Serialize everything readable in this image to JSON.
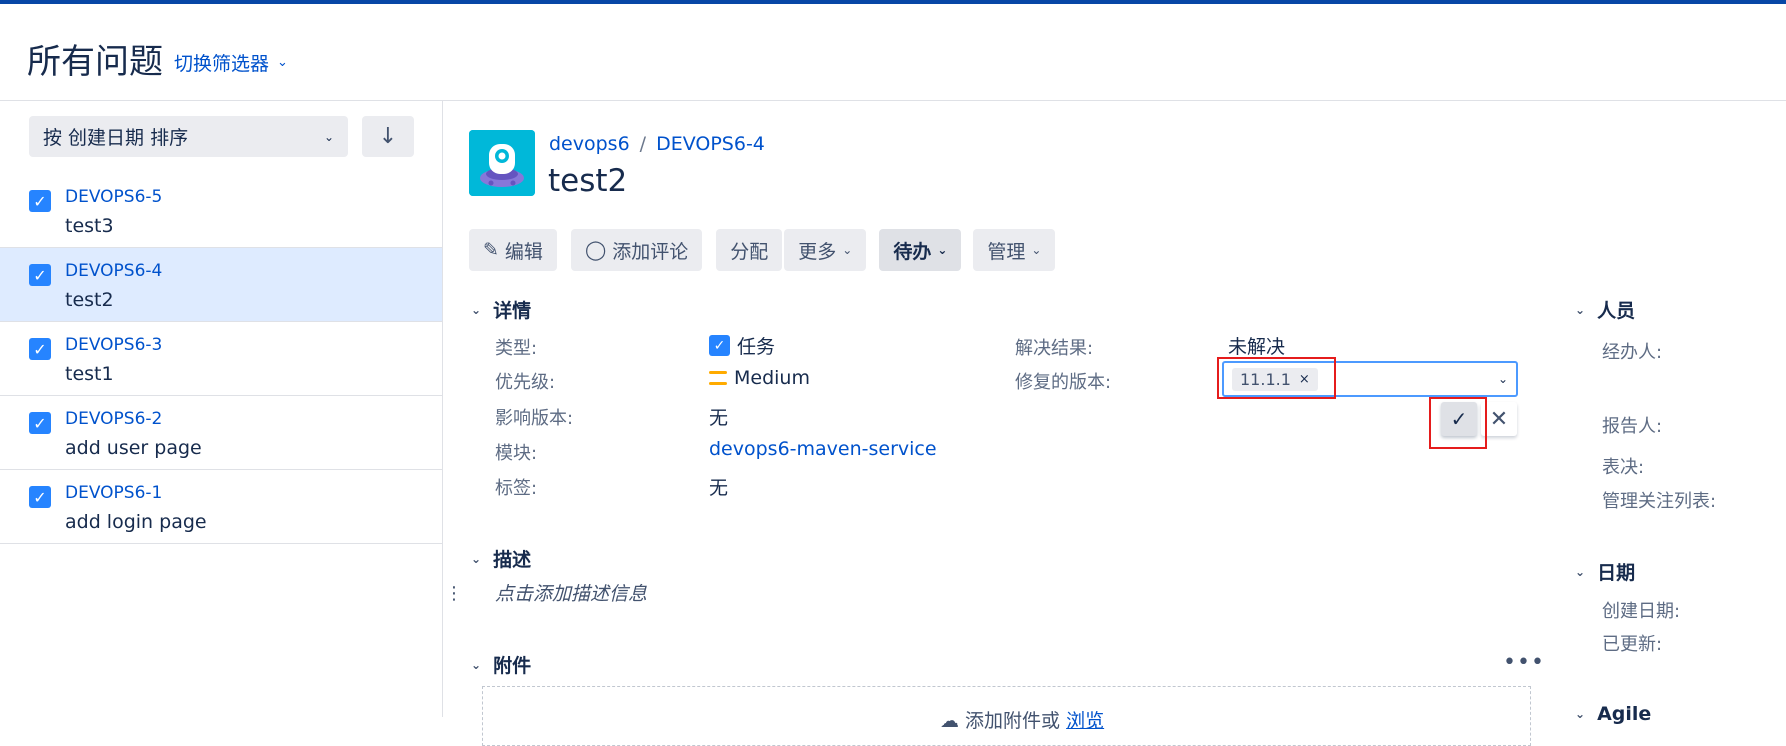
{
  "header": {
    "title": "所有问题",
    "filter_switch": "切换筛选器"
  },
  "sidebar": {
    "sort_label": "按 创建日期 排序",
    "items": [
      {
        "key": "DEVOPS6-5",
        "summary": "test3"
      },
      {
        "key": "DEVOPS6-4",
        "summary": "test2"
      },
      {
        "key": "DEVOPS6-3",
        "summary": "test1"
      },
      {
        "key": "DEVOPS6-2",
        "summary": "add user page"
      },
      {
        "key": "DEVOPS6-1",
        "summary": "add login page"
      }
    ]
  },
  "issue": {
    "project": "devops6",
    "key": "DEVOPS6-4",
    "title": "test2"
  },
  "toolbar": {
    "edit": "编辑",
    "comment": "添加评论",
    "assign": "分配",
    "more": "更多",
    "status": "待办",
    "admin": "管理"
  },
  "details": {
    "heading": "详情",
    "type_label": "类型:",
    "type_value": "任务",
    "priority_label": "优先级:",
    "priority_value": "Medium",
    "affects_label": "影响版本:",
    "affects_value": "无",
    "component_label": "模块:",
    "component_value": "devops6-maven-service",
    "labels_label": "标签:",
    "labels_value": "无",
    "resolution_label": "解决结果:",
    "resolution_value": "未解决",
    "fix_version_label": "修复的版本:",
    "fix_version_tag": "11.1.1"
  },
  "description": {
    "heading": "描述",
    "placeholder": "点击添加描述信息"
  },
  "attachments": {
    "heading": "附件",
    "drop_text": "添加附件或",
    "browse": "浏览"
  },
  "people": {
    "heading": "人员",
    "assignee_label": "经办人:",
    "reporter_label": "报告人:",
    "votes_label": "表决:",
    "watchers_label": "管理关注列表:"
  },
  "dates": {
    "heading": "日期",
    "created_label": "创建日期:",
    "updated_label": "已更新:"
  },
  "agile": {
    "heading": "Agile"
  },
  "colors": {
    "link": "#0052cc",
    "highlight_box": "#e51c1c",
    "selected_row": "#deebff"
  }
}
